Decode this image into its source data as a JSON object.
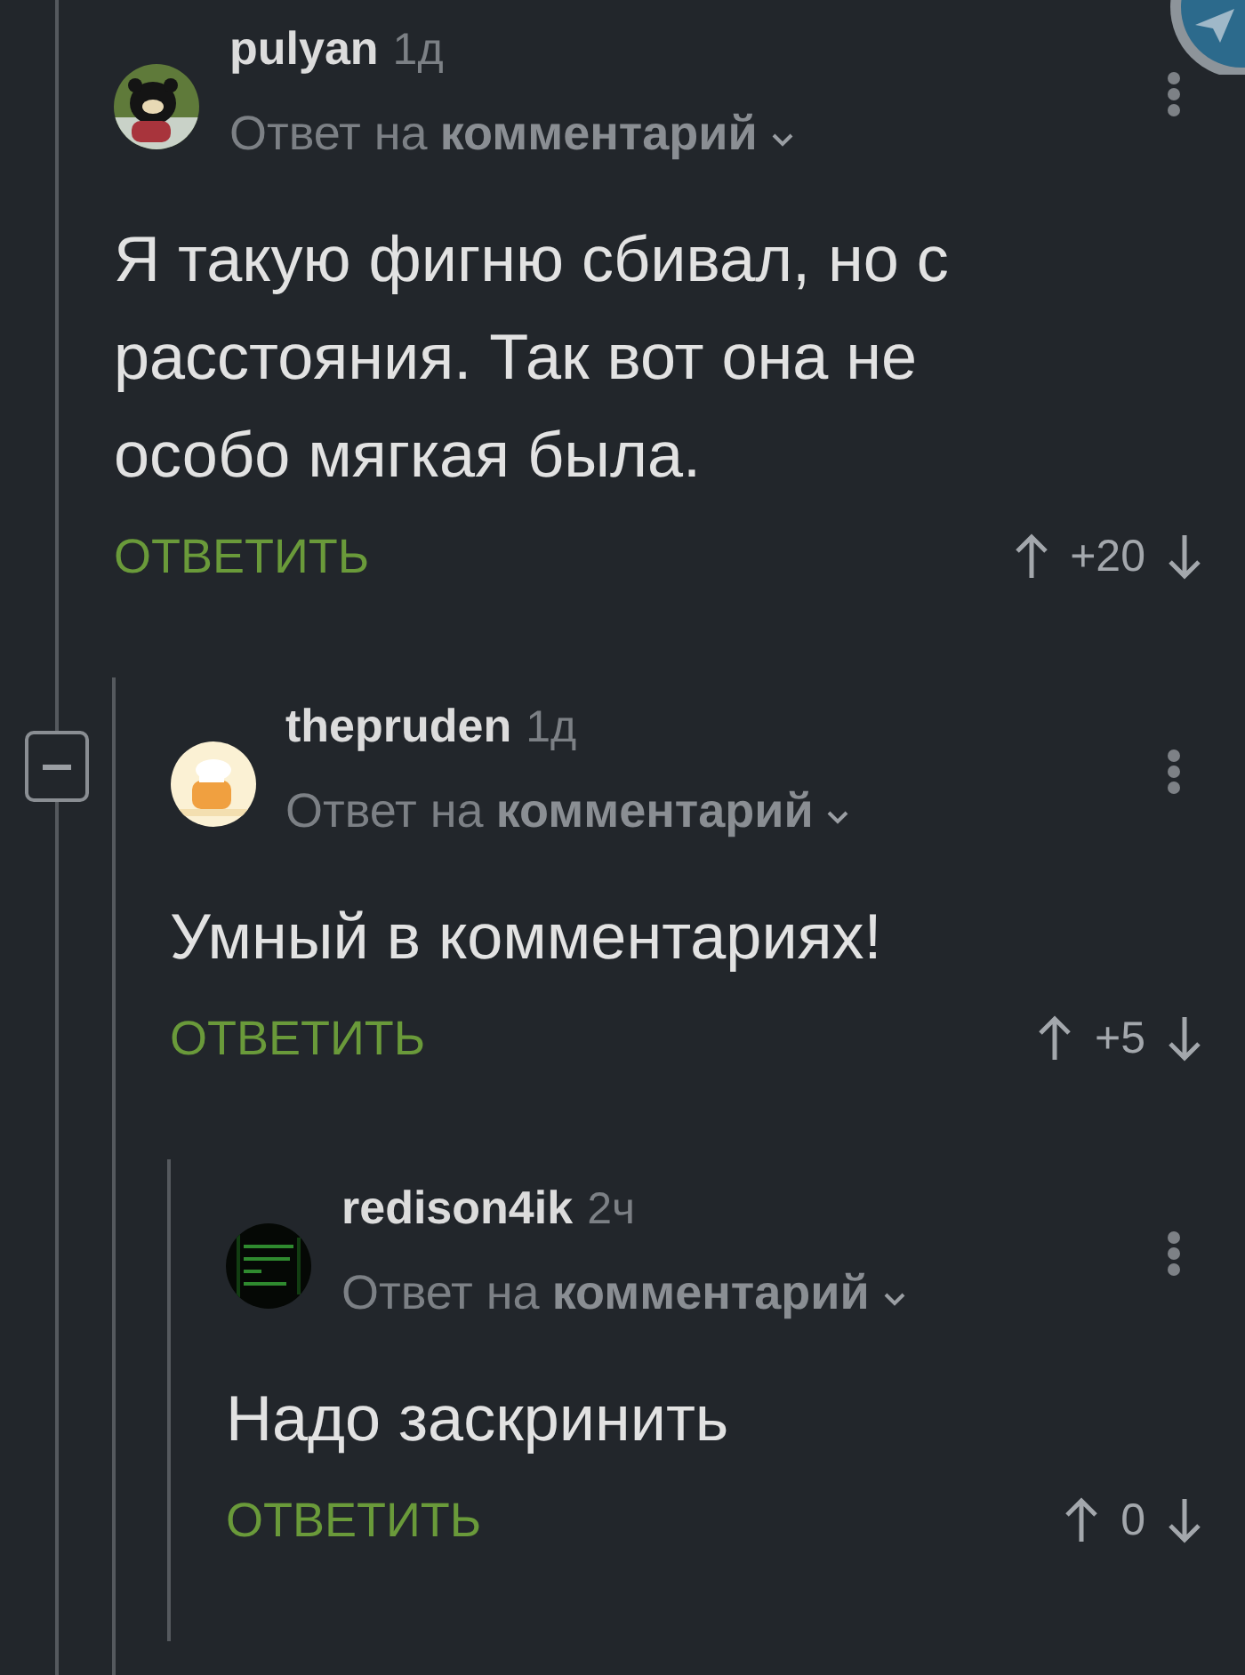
{
  "comments": [
    {
      "author": "pulyan",
      "time": "1д",
      "reply_prefix": "Ответ на",
      "reply_target": "комментарий",
      "text": "Я такую фигню сбивал, но с расстояния. Так вот она не особо мягкая была.",
      "reply_label": "ОТВЕТИТЬ",
      "score": "+20",
      "children": [
        {
          "author": "thepruden",
          "time": "1д",
          "reply_prefix": "Ответ на",
          "reply_target": "комментарий",
          "text": "Умный в комментариях!",
          "reply_label": "ОТВЕТИТЬ",
          "score": "+5",
          "expanded": true,
          "children": [
            {
              "author": "redison4ik",
              "time": "2ч",
              "reply_prefix": "Ответ на",
              "reply_target": "комментарий",
              "text": "Надо заскринить",
              "reply_label": "ОТВЕТИТЬ",
              "score": "0"
            }
          ]
        }
      ]
    }
  ]
}
